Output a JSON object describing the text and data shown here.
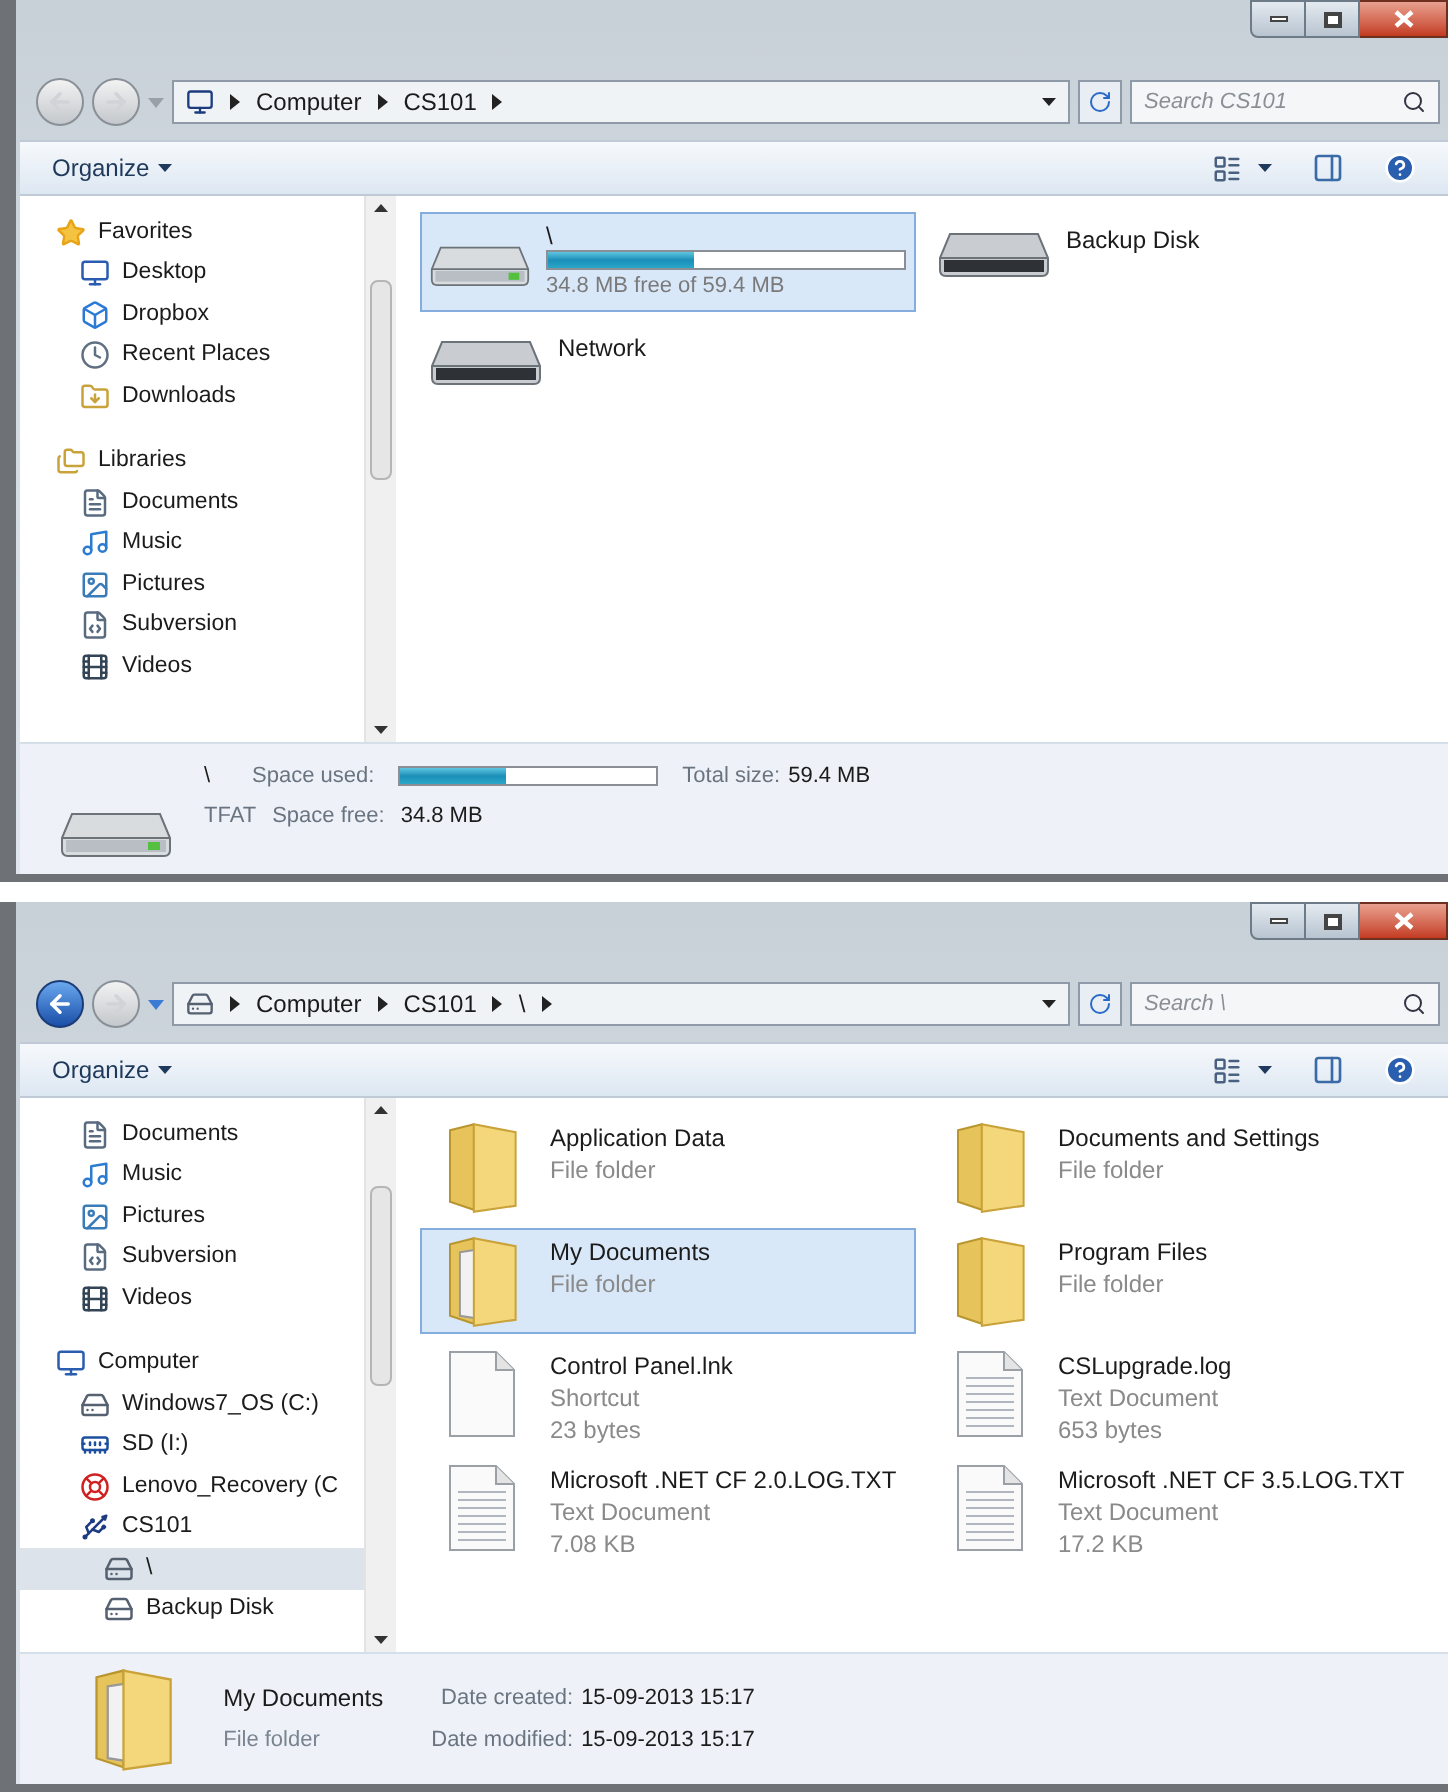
{
  "windows": [
    {
      "nav": {
        "back_enabled": false
      },
      "address": {
        "crumbs": [
          "Computer",
          "CS101"
        ]
      },
      "search": {
        "placeholder": "Search CS101"
      },
      "toolbar": {
        "organize": "Organize"
      },
      "sidebar": [
        {
          "label": "Favorites",
          "kind": "star",
          "selected": false,
          "children": [
            {
              "label": "Desktop",
              "kind": "desktop",
              "selected": false
            },
            {
              "label": "Dropbox",
              "kind": "box",
              "selected": false
            },
            {
              "label": "Recent Places",
              "kind": "clock",
              "selected": false
            },
            {
              "label": "Downloads",
              "kind": "download",
              "selected": false
            }
          ]
        },
        {
          "label": "Libraries",
          "kind": "library",
          "selected": false,
          "children": [
            {
              "label": "Documents",
              "kind": "document",
              "selected": false
            },
            {
              "label": "Music",
              "kind": "music",
              "selected": false
            },
            {
              "label": "Pictures",
              "kind": "picture",
              "selected": false
            },
            {
              "label": "Subversion",
              "kind": "code",
              "selected": false
            },
            {
              "label": "Videos",
              "kind": "film",
              "selected": false
            }
          ]
        }
      ],
      "content": {
        "items": [
          {
            "kind": "drive-bar",
            "name": "\\",
            "level": 0.41,
            "free": "34.8 MB free of 59.4 MB",
            "selected": true
          },
          {
            "kind": "drive",
            "name": "Backup Disk",
            "selected": false
          },
          {
            "kind": "drive",
            "name": "Network",
            "selected": false
          }
        ]
      },
      "details": {
        "kind": "drive",
        "name": "\\",
        "filesystem": "TFAT",
        "used_label": "Space used:",
        "level": 0.41,
        "total": {
          "label": "Total size:",
          "value": "59.4 MB"
        },
        "free": {
          "label": "Space free:",
          "value": "34.8 MB"
        }
      }
    },
    {
      "nav": {
        "back_enabled": true
      },
      "address": {
        "crumbs": [
          "Computer",
          "CS101",
          "\\"
        ]
      },
      "search": {
        "placeholder": "Search \\"
      },
      "toolbar": {
        "organize": "Organize"
      },
      "sidebar": [
        {
          "children": [
            {
              "label": "Documents",
              "kind": "document",
              "selected": false
            },
            {
              "label": "Music",
              "kind": "music",
              "selected": false
            },
            {
              "label": "Pictures",
              "kind": "picture",
              "selected": false
            },
            {
              "label": "Subversion",
              "kind": "code",
              "selected": false
            },
            {
              "label": "Videos",
              "kind": "film",
              "selected": false
            }
          ]
        },
        {
          "label": "Computer",
          "kind": "desktop",
          "selected": false,
          "children": [
            {
              "label": "Windows7_OS (C:)",
              "kind": "drive",
              "selected": false
            },
            {
              "label": "SD (I:)",
              "kind": "sd",
              "selected": false
            },
            {
              "label": "Lenovo_Recovery (C",
              "kind": "recovery",
              "selected": false
            },
            {
              "label": "CS101",
              "kind": "usb",
              "selected": false,
              "children": [
                {
                  "label": "\\",
                  "kind": "drive",
                  "selected": true
                },
                {
                  "label": "Backup Disk",
                  "kind": "drive",
                  "selected": false
                }
              ]
            }
          ]
        }
      ],
      "content": {
        "items": [
          {
            "kind": "folder",
            "name": "Application Data",
            "lines": [
              "File folder"
            ],
            "selected": false
          },
          {
            "kind": "folder",
            "name": "Documents and Settings",
            "lines": [
              "File folder"
            ],
            "selected": false
          },
          {
            "kind": "folder",
            "name": "My Documents",
            "lines": [
              "File folder"
            ],
            "selected": true
          },
          {
            "kind": "folder",
            "name": "Program Files",
            "lines": [
              "File folder"
            ],
            "selected": false
          },
          {
            "kind": "blank",
            "name": "Control Panel.lnk",
            "lines": [
              "Shortcut",
              "23 bytes"
            ],
            "selected": false
          },
          {
            "kind": "text",
            "name": "CSLupgrade.log",
            "lines": [
              "Text Document",
              "653 bytes"
            ],
            "selected": false
          },
          {
            "kind": "text",
            "name": "Microsoft .NET CF 2.0.LOG.TXT",
            "lines": [
              "Text Document",
              "7.08 KB"
            ],
            "selected": false
          },
          {
            "kind": "text",
            "name": "Microsoft .NET CF 3.5.LOG.TXT",
            "lines": [
              "Text Document",
              "17.2 KB"
            ],
            "selected": false
          }
        ]
      },
      "details": {
        "kind": "folder",
        "name": "My Documents",
        "type": "File folder",
        "fields": [
          {
            "label": "Date created:",
            "value": "15-09-2013 15:17"
          },
          {
            "label": "Date modified:",
            "value": "15-09-2013 15:17"
          }
        ]
      }
    }
  ]
}
